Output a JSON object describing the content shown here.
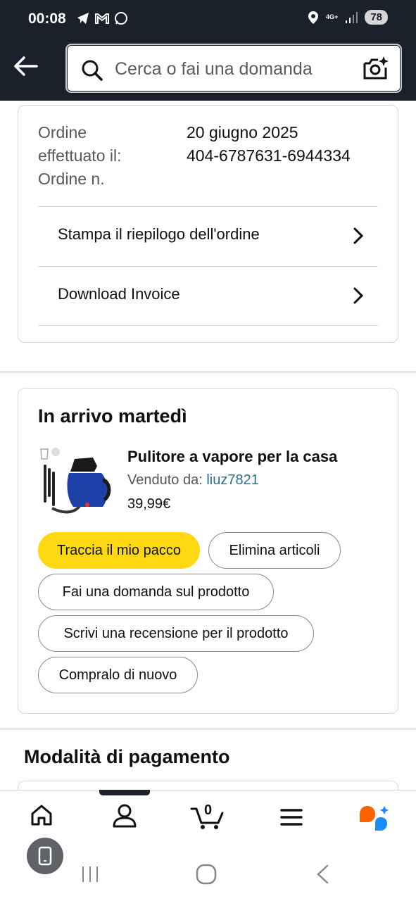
{
  "status_bar": {
    "time": "00:08",
    "network": "4G+",
    "battery": "78"
  },
  "header": {
    "search_placeholder": "Cerca o fai una domanda"
  },
  "order_info": {
    "placed_label": "Ordine effettuato il:",
    "placed_label_line1": "Ordine",
    "placed_label_line2": "effettuato il:",
    "number_label": "Ordine n.",
    "date": "20 giugno 2025",
    "number": "404-6787631-6944334",
    "links": [
      {
        "label": "Stampa il riepilogo dell'ordine"
      },
      {
        "label": "Download Invoice"
      }
    ]
  },
  "shipment": {
    "heading": "In arrivo martedì",
    "product": {
      "title": "Pulitore a vapore per la casa",
      "sold_by_label": "Venduto da:",
      "seller": "liuz7821",
      "price": "39,99€"
    },
    "actions": {
      "track": "Traccia il mio pacco",
      "delete": "Elimina articoli",
      "ask": "Fai una domanda sul prodotto",
      "review": "Scrivi una recensione per il prodotto",
      "buy_again": "Compralo di nuovo"
    }
  },
  "payment": {
    "heading": "Modalità di pagamento"
  },
  "bottom_nav": {
    "cart_count": "0"
  },
  "colors": {
    "header_bg": "#1a212b",
    "primary_button": "#ffd814",
    "link": "#2a6f8f",
    "assistant_orange": "#ff6200",
    "assistant_blue": "#1a8cff"
  }
}
